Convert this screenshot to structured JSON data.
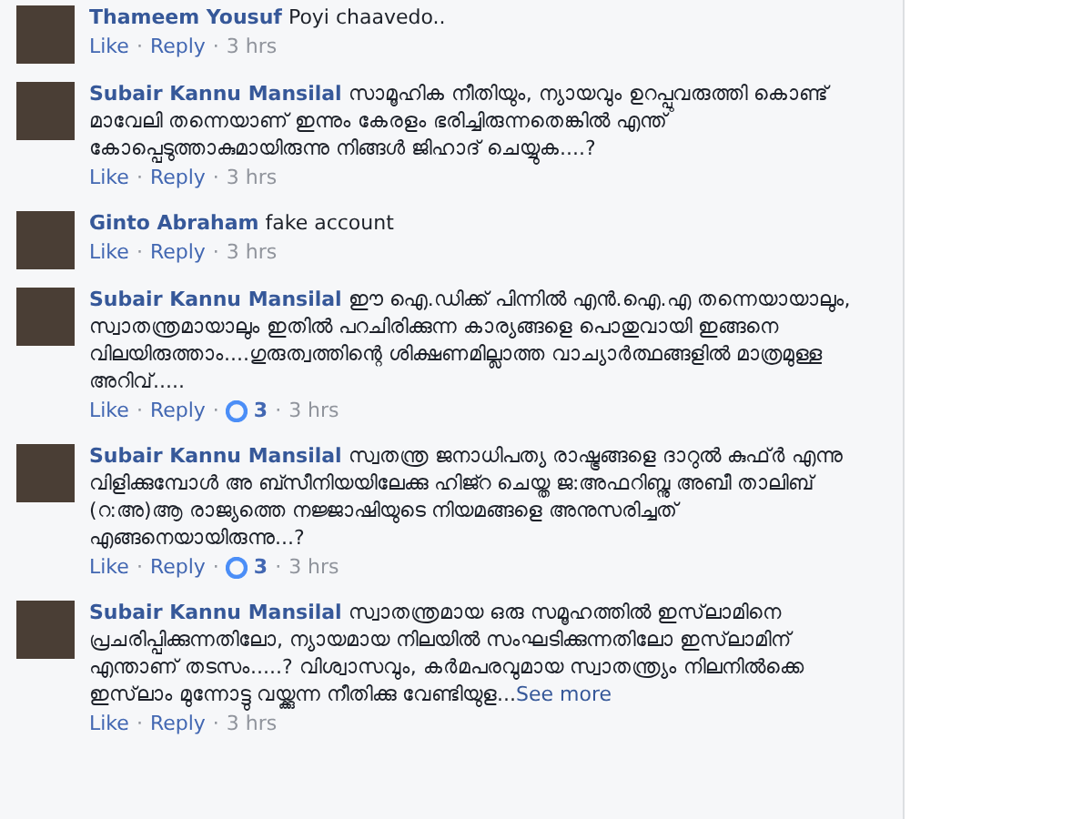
{
  "separator": "·",
  "comments": [
    {
      "author": "Thameem Yousuf",
      "text": "Poyi chaavedo..",
      "actions": [
        "Like",
        "Reply"
      ],
      "time": "3 hrs"
    },
    {
      "author": "Subair Kannu Mansilal",
      "text": "സാമൂഹിക നീതിയും, ന്യായവും ഉറപ്പുവരുത്തി കൊണ്ട് മാവേലി തന്നെയാണ് ഇന്നും കേരളം ഭരിച്ചിരുന്നതെങ്കിൽ എന്ത് കോപ്പെടുത്താകുമായിരുന്നു നിങ്ങൾ ജിഹാദ് ചെയ്യുക....?",
      "actions": [
        "Like",
        "Reply"
      ],
      "time": "3 hrs"
    },
    {
      "author": "Ginto Abraham",
      "text": "fake account",
      "actions": [
        "Like",
        "Reply"
      ],
      "time": "3 hrs"
    },
    {
      "author": "Subair Kannu Mansilal",
      "text": "ഈ ഐ.ഡിക്ക് പിന്നിൽ എൻ.ഐ.എ തന്നെയായാലും, സ്വാതന്ത്രമായാലും ഇതിൽ പറചിരിക്കുന്ന കാര്യങ്ങളെ പൊതുവായി ഇങ്ങനെ വിലയിരുത്താം....ഗുരുത്വത്തിന്റെ ശിക്ഷണമില്ലാത്ത വാച്യാർത്ഥങ്ങളിൽ മാത്രമുള്ള അറിവ്.....",
      "actions": [
        "Like",
        "Reply"
      ],
      "reactions": "3",
      "time": "3 hrs"
    },
    {
      "author": "Subair Kannu Mansilal",
      "text": "സ്വതന്ത്ര ജനാധിപത്യ രാഷ്ട്രങ്ങളെ ദാറുൽ കുഫ്ർ എന്നു വിളിക്കുമ്പോൾ അ ബ്സീനിയയിലേക്കു ഹിജ്റ ചെയ്ത ജ:അഫറിബ്നു അബീ താലിബ് (റ:അ)ആ രാജ്യത്തെ നജ്ജാഷിയുടെ നിയമങ്ങളെ അനുസരിച്ചത് എങ്ങനെയായിരുന്നു...?",
      "actions": [
        "Like",
        "Reply"
      ],
      "reactions": "3",
      "time": "3 hrs"
    },
    {
      "author": "Subair Kannu Mansilal",
      "text": "സ്വാതന്ത്രമായ ഒരു സമൂഹത്തിൽ ഇസ്‌ലാമിനെ പ്രചരിപ്പിക്കുന്നതിലോ, ന്യായമായ നിലയിൽ സംഘടിക്കുന്നതിലോ ഇസ്‌ലാമിന് എന്താണ് തടസം.....? വിശ്വാസവും, കർമപരവുമായ സ്വാതന്ത്ര്യം നിലനിൽക്കെ ഇസ്‌ലാം മുന്നോട്ടു വയ്ക്കുന്ന നീതിക്കു വേണ്ടിയുള...",
      "see_more": "See more",
      "actions": [
        "Like",
        "Reply"
      ],
      "time": "3 hrs"
    }
  ]
}
